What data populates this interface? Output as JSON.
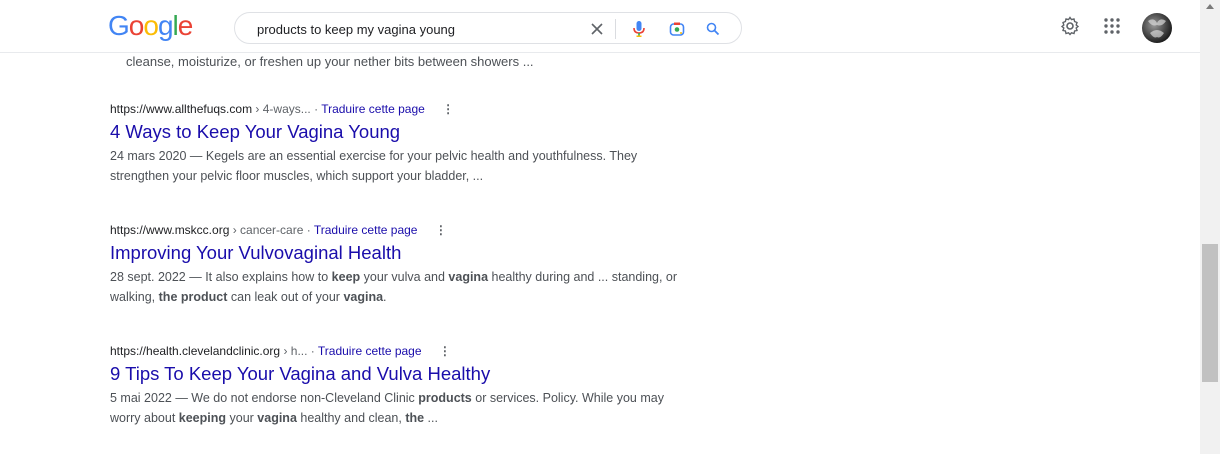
{
  "header": {
    "logo_letters": [
      {
        "char": "G",
        "color": "#4285F4"
      },
      {
        "char": "o",
        "color": "#EA4335"
      },
      {
        "char": "o",
        "color": "#FBBC05"
      },
      {
        "char": "g",
        "color": "#4285F4"
      },
      {
        "char": "l",
        "color": "#34A853"
      },
      {
        "char": "e",
        "color": "#EA4335"
      }
    ],
    "search_query": "products to keep my vagina young",
    "icons": [
      "close-icon",
      "microphone-icon",
      "lens-icon",
      "search-icon",
      "settings-icon",
      "apps-grid-icon",
      "avatar"
    ]
  },
  "snippet_top": "cleanse, moisturize, or freshen up your nether bits between showers ...",
  "results": [
    {
      "domain": "https://www.allthefuqs.com",
      "path": " › 4-ways...",
      "translate": "Traduire cette page",
      "title": "4 Ways to Keep Your Vagina Young",
      "desc_parts": [
        {
          "t": "24 mars 2020 — Kegels are an essential exercise for your pelvic health and youthfulness. They strengthen your pelvic floor muscles, which support your bladder, ...",
          "b": false
        }
      ]
    },
    {
      "domain": "https://www.mskcc.org",
      "path": " › cancer-care",
      "translate": "Traduire cette page",
      "title": "Improving Your Vulvovaginal Health",
      "desc_parts": [
        {
          "t": "28 sept. 2022 — It also explains how to ",
          "b": false
        },
        {
          "t": "keep",
          "b": true
        },
        {
          "t": " your vulva and ",
          "b": false
        },
        {
          "t": "vagina",
          "b": true
        },
        {
          "t": " healthy during and ... standing, or walking, ",
          "b": false
        },
        {
          "t": "the product",
          "b": true
        },
        {
          "t": " can leak out of your ",
          "b": false
        },
        {
          "t": "vagina",
          "b": true
        },
        {
          "t": ".",
          "b": false
        }
      ]
    },
    {
      "domain": "https://health.clevelandclinic.org",
      "path": " › h...",
      "translate": "Traduire cette page",
      "title": "9 Tips To Keep Your Vagina and Vulva Healthy",
      "desc_parts": [
        {
          "t": "5 mai 2022 — We do not endorse non-Cleveland Clinic ",
          "b": false
        },
        {
          "t": "products",
          "b": true
        },
        {
          "t": " or services. Policy. While you may worry about ",
          "b": false
        },
        {
          "t": "keeping",
          "b": true
        },
        {
          "t": " your ",
          "b": false
        },
        {
          "t": "vagina",
          "b": true
        },
        {
          "t": " healthy and clean, ",
          "b": false
        },
        {
          "t": "the",
          "b": true
        },
        {
          "t": " ...",
          "b": false
        }
      ]
    }
  ],
  "colors": {
    "link": "#1a0dab",
    "text": "#4d5156"
  }
}
